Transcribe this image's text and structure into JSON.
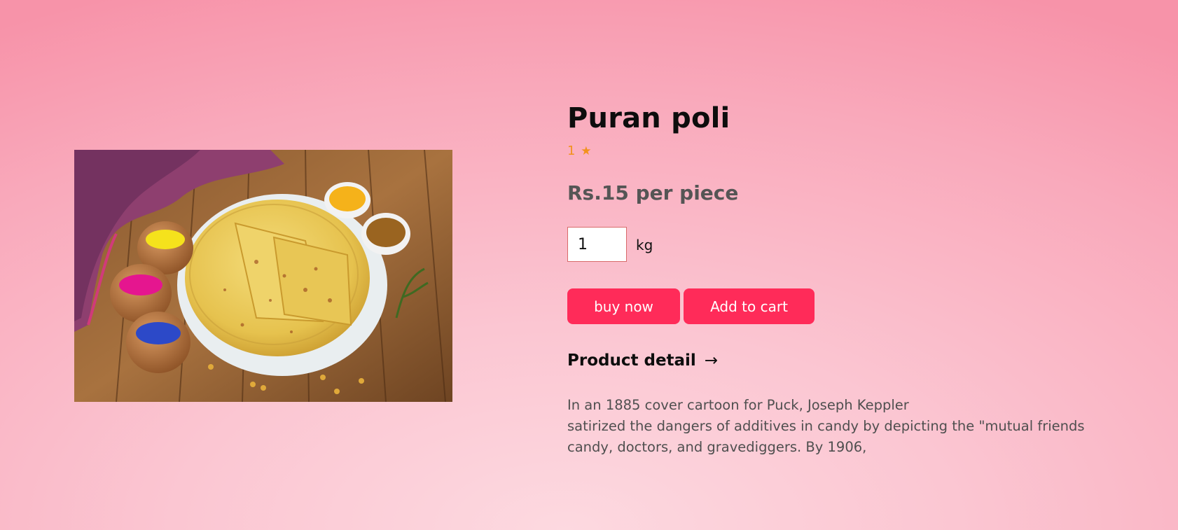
{
  "product": {
    "title": "Puran poli",
    "rating": "1",
    "rating_icon": "star-icon",
    "price": "Rs.15 per piece",
    "quantity_value": "1",
    "unit": "kg",
    "buy_label": "buy now",
    "cart_label": "Add to cart",
    "detail_label": "Product detail",
    "detail_arrow": "→",
    "description_lines": [
      "In an 1885 cover cartoon for Puck, Joseph Keppler",
      "satirized the dangers of additives in candy by depicting the \"mutual friends",
      "candy, doctors, and gravediggers. By 1906,"
    ]
  },
  "colors": {
    "accent": "#ff2b59",
    "rating": "#f2921c",
    "price": "#555555"
  }
}
